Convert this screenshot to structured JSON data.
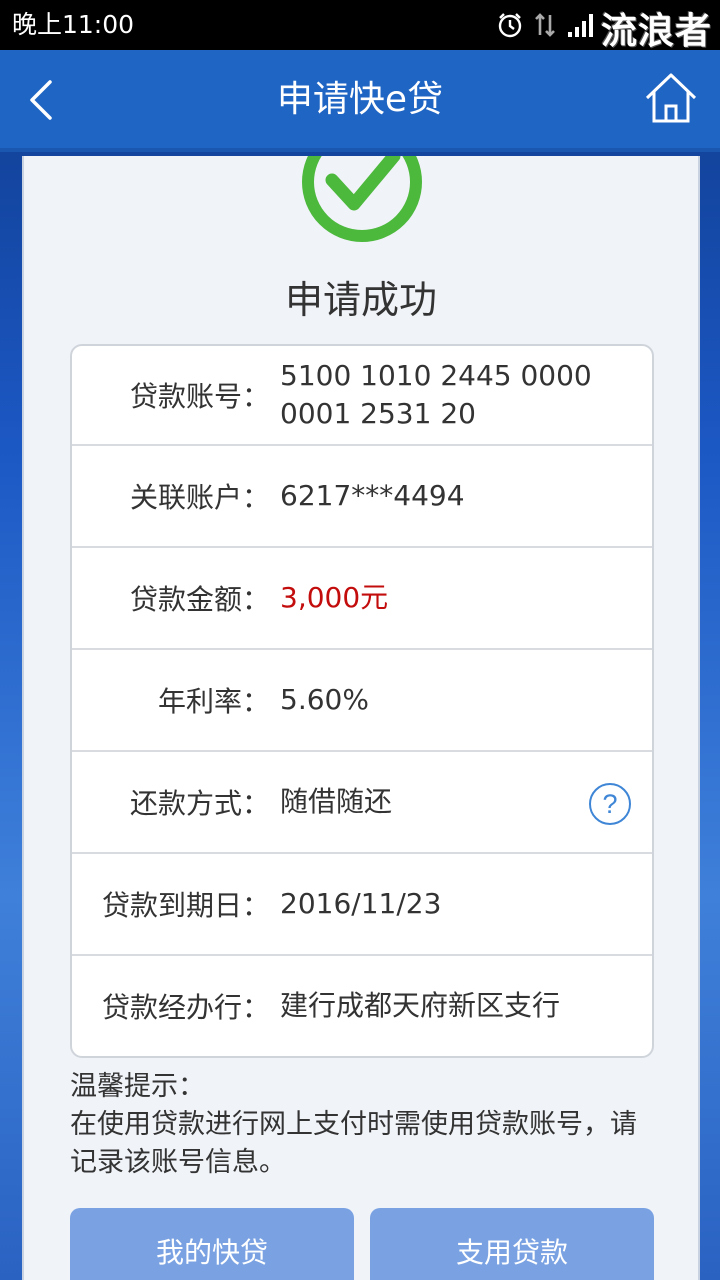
{
  "status_bar": {
    "time": "晚上11:00",
    "watermark": "流浪者",
    "icons": [
      "alarm-icon",
      "data-arrows-icon",
      "signal-icon"
    ]
  },
  "navbar": {
    "title": "申请快e贷",
    "icons": [
      "back-chevron-icon",
      "home-icon"
    ]
  },
  "colors": {
    "nav": "#1f65c4",
    "success_green": "#4cb83c",
    "amount_red": "#c30d0d",
    "help_blue": "#3f86d6",
    "button": "#7aa2e3"
  },
  "result": {
    "title": "申请成功",
    "icon": "check-circle-icon"
  },
  "details": [
    {
      "label": "贷款账号：",
      "value": "5100 1010 2445 0000 0001 2531 20"
    },
    {
      "label": "关联账户：",
      "value": "6217***4494"
    },
    {
      "label": "贷款金额：",
      "value": "3,000元"
    },
    {
      "label": "年利率：",
      "value": "5.60%"
    },
    {
      "label": "还款方式：",
      "value": "随借随还",
      "icon": "question-circle-icon"
    },
    {
      "label": "贷款到期日：",
      "value": "2016/11/23"
    },
    {
      "label": "贷款经办行：",
      "value": "建行成都天府新区支行"
    }
  ],
  "tip": {
    "heading": "温馨提示：",
    "text": "在使用贷款进行网上支付时需使用贷款账号，请记录该账号信息。"
  },
  "buttons": {
    "my_loans": "我的快贷",
    "use_loan": "支用贷款"
  }
}
